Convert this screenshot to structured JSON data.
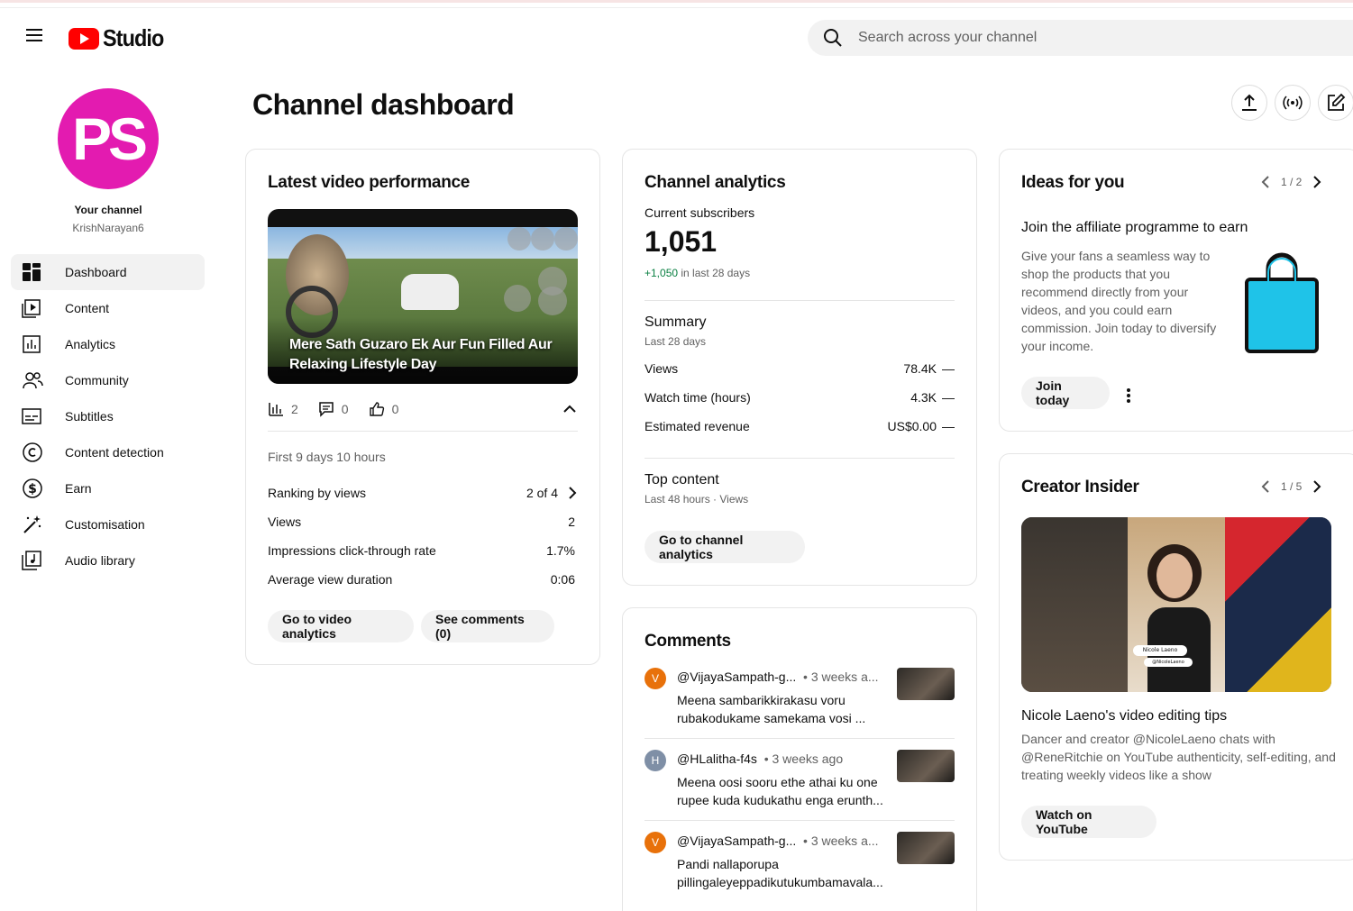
{
  "app": {
    "logo_text": "Studio",
    "search_placeholder": "Search across your channel"
  },
  "channel": {
    "initials": "PS",
    "your_channel_label": "Your channel",
    "handle": "KrishNarayan6",
    "avatar_color": "#e31bb0"
  },
  "sidebar": {
    "items": [
      {
        "label": "Dashboard",
        "icon": "dashboard-icon",
        "active": true
      },
      {
        "label": "Content",
        "icon": "content-icon"
      },
      {
        "label": "Analytics",
        "icon": "analytics-icon"
      },
      {
        "label": "Community",
        "icon": "community-icon"
      },
      {
        "label": "Subtitles",
        "icon": "subtitles-icon"
      },
      {
        "label": "Content detection",
        "icon": "copyright-icon"
      },
      {
        "label": "Earn",
        "icon": "dollar-icon"
      },
      {
        "label": "Customisation",
        "icon": "magic-wand-icon"
      },
      {
        "label": "Audio library",
        "icon": "audio-library-icon"
      }
    ]
  },
  "page": {
    "title": "Channel dashboard"
  },
  "latest_video": {
    "card_title": "Latest video performance",
    "video_title": "Mere Sath Guzaro Ek Aur Fun Filled Aur Relaxing Lifestyle Day",
    "views_count": "2",
    "comments_count": "0",
    "likes_count": "0",
    "period": "First 9 days 10 hours",
    "rows": [
      {
        "label": "Ranking by views",
        "value": "2 of 4"
      },
      {
        "label": "Views",
        "value": "2"
      },
      {
        "label": "Impressions click-through rate",
        "value": "1.7%"
      },
      {
        "label": "Average view duration",
        "value": "0:06"
      }
    ],
    "btn_analytics": "Go to video analytics",
    "btn_comments": "See comments (0)"
  },
  "analytics": {
    "card_title": "Channel analytics",
    "subs_label": "Current subscribers",
    "subs_count": "1,051",
    "subs_change": "+1,050",
    "subs_change_suffix": " in last 28 days",
    "summary_title": "Summary",
    "summary_sub": "Last 28 days",
    "rows": [
      {
        "label": "Views",
        "value": "78.4K",
        "trend": "—"
      },
      {
        "label": "Watch time (hours)",
        "value": "4.3K",
        "trend": "—"
      },
      {
        "label": "Estimated revenue",
        "value": "US$0.00",
        "trend": "—"
      }
    ],
    "top_title": "Top content",
    "top_sub": "Last 48 hours · Views",
    "btn": "Go to channel analytics"
  },
  "comments": {
    "card_title": "Comments",
    "items": [
      {
        "initial": "V",
        "color": "#e8710a",
        "author": "@VijayaSampath-g...",
        "time": "• 3 weeks a...",
        "text": "Meena sambarikkirakasu voru rubakodukame samekama vosi ..."
      },
      {
        "initial": "H",
        "color": "#7f8fa6",
        "author": "@HLalitha-f4s",
        "time": "• 3 weeks ago",
        "text": "Meena oosi sooru ethe athai ku one rupee kuda kudukathu enga erunth..."
      },
      {
        "initial": "V",
        "color": "#e8710a",
        "author": "@VijayaSampath-g...",
        "time": "• 3 weeks a...",
        "text": "Pandi nallaporupa pillingaleyeppadikutukumbamavala..."
      }
    ]
  },
  "ideas": {
    "card_title": "Ideas for you",
    "pager": "1 / 2",
    "title": "Join the affiliate programme to earn",
    "text": "Give your fans a seamless way to shop the products that you recommend directly from your videos, and you could earn commission. Join today to diversify your income.",
    "btn": "Join today",
    "bag_color": "#1fc3e8"
  },
  "creator": {
    "card_title": "Creator Insider",
    "pager": "1 / 5",
    "thumb_caption": "Nicole Laeno",
    "thumb_handle": "@NicoleLaeno",
    "title": "Nicole Laeno's video editing tips",
    "text": "Dancer and creator @NicoleLaeno chats with @ReneRitchie on YouTube authenticity, self-editing, and treating weekly videos like a show",
    "btn": "Watch on YouTube"
  }
}
